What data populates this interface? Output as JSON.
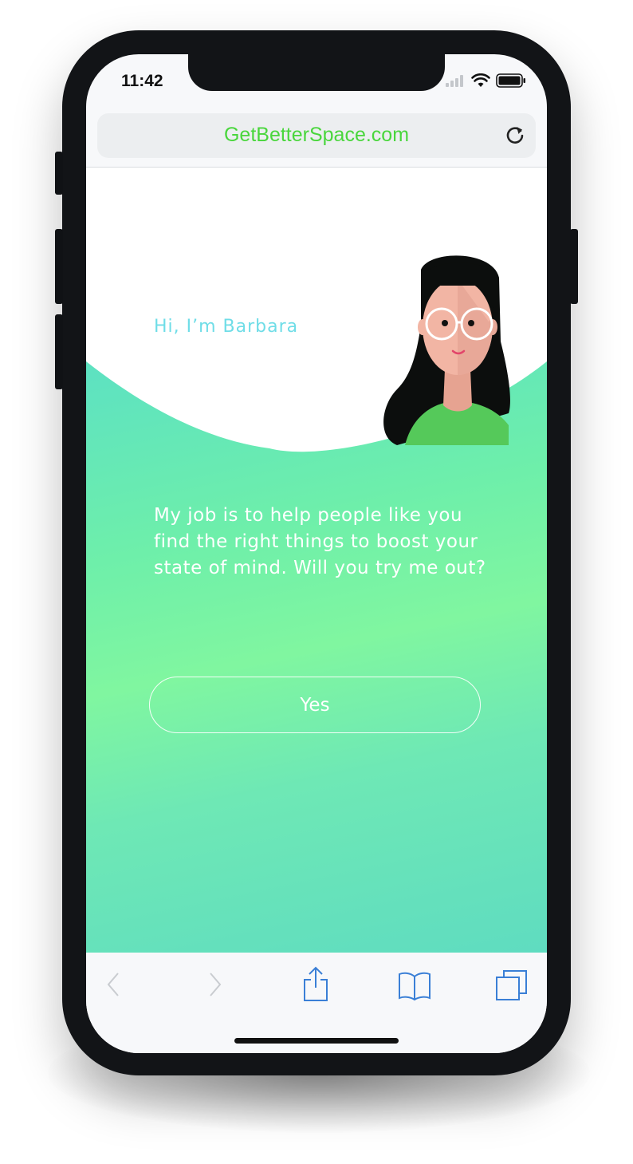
{
  "status_bar": {
    "time": "11:42"
  },
  "browser": {
    "url": "GetBetterSpace.com"
  },
  "page": {
    "greeting": "Hi, I’m Barbara",
    "message": "My job is to help people like you find the right things to boost your state of mind. Will you try me out?",
    "yes_button": "Yes"
  },
  "colors": {
    "url_text": "#49d63c",
    "greeting_text": "#6fdde7",
    "gradient_top": "#52d2cc",
    "gradient_mid": "#80f6a0",
    "toolbar_icon": "#3a7fd6"
  },
  "toolbar": {
    "icons": [
      "back-icon",
      "forward-icon",
      "share-icon",
      "bookmarks-icon",
      "tabs-icon"
    ]
  }
}
